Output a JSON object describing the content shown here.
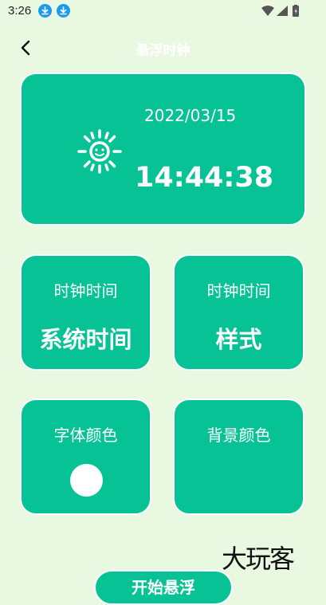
{
  "status_bar": {
    "time": "3:26",
    "icons": [
      "download-icon",
      "download-icon",
      "wifi-icon",
      "signal-icon",
      "battery-icon"
    ]
  },
  "header": {
    "back_icon": "back-arrow-icon",
    "title": "悬浮时钟"
  },
  "clock_card": {
    "date": "2022/03/15",
    "time": "14:44:38",
    "icon": "sun-icon"
  },
  "options": {
    "clock_time_source": {
      "label": "时钟时间",
      "value": "系统时间"
    },
    "clock_time_style": {
      "label": "时钟时间",
      "value": "样式"
    },
    "font_color": {
      "label": "字体颜色",
      "color": "#ffffff"
    },
    "background_color": {
      "label": "背景颜色"
    }
  },
  "bottom_button": {
    "label": "开始悬浮"
  },
  "watermark": "大玩客",
  "colors": {
    "background": "#e9f8e1",
    "card": "#06c295",
    "card_border": "#ffffff",
    "accent_blue": "#1a9bec"
  }
}
